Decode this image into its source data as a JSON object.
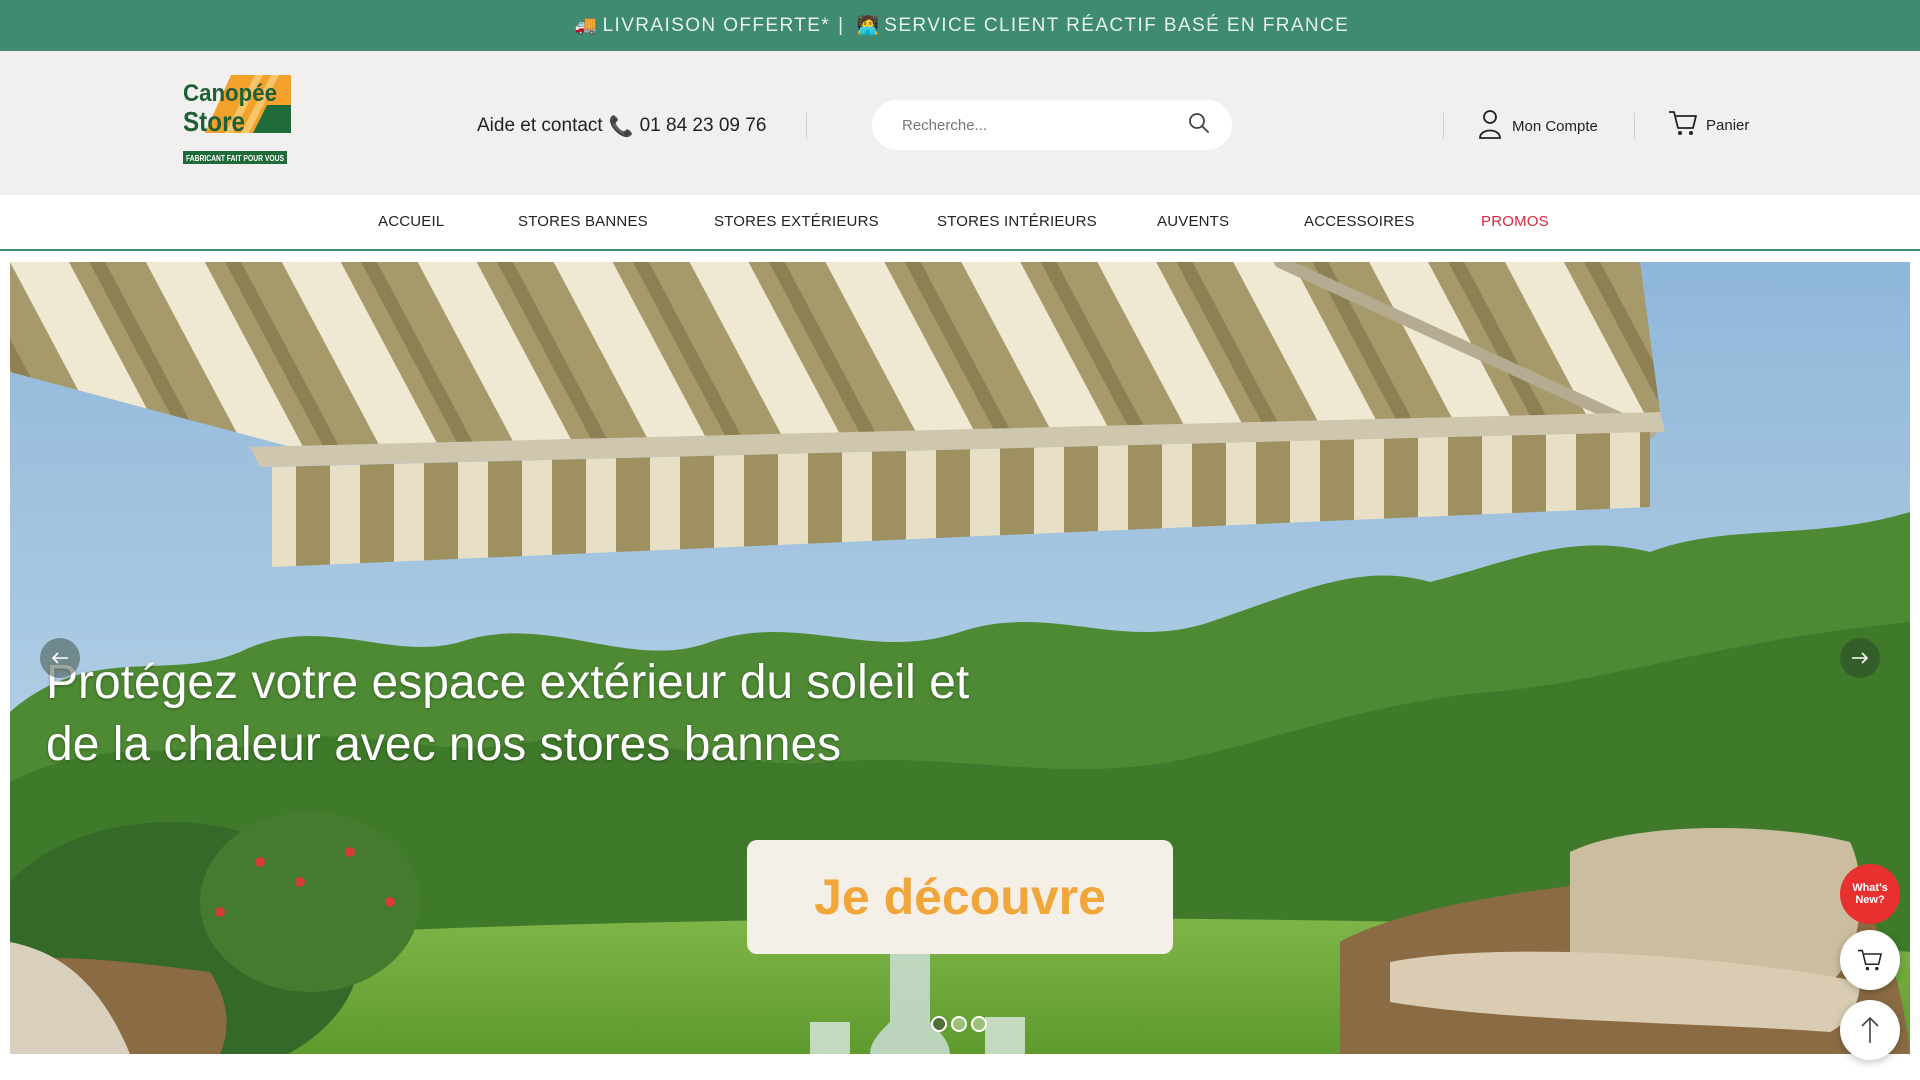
{
  "topbar": {
    "truck_emoji": "🚚",
    "shipping": "LIVRAISON OFFERTE*",
    "separator": "|",
    "agent_emoji": "🧑‍💻",
    "service": "SERVICE CLIENT RÉACTIF BASÉ EN FRANCE"
  },
  "header": {
    "logo_line1": "Canopée",
    "logo_line2": "Store",
    "logo_tagline": "FABRICANT FAIT POUR VOUS",
    "help_label": "Aide et contact",
    "phone_icon": "📞",
    "phone": "01 84 23 09 76",
    "search_placeholder": "Recherche...",
    "account_label": "Mon Compte",
    "cart_label": "Panier"
  },
  "nav": {
    "items": [
      "ACCUEIL",
      "STORES BANNES",
      "STORES EXTÉRIEURS",
      "STORES INTÉRIEURS",
      "AUVENTS",
      "ACCESSOIRES",
      "PROMOS"
    ]
  },
  "hero": {
    "title_line1": "Protégez votre espace extérieur du soleil et",
    "title_line2": "de la chaleur avec nos stores bannes",
    "cta_label": "Je découvre",
    "slide_count": 3,
    "active_slide": 1
  },
  "widgets": {
    "whats_new_line1": "What's",
    "whats_new_line2": "New?"
  },
  "colors": {
    "brand_green": "#3f8a72",
    "promo_red": "#d4293a",
    "cta_orange": "#f0a63b"
  }
}
